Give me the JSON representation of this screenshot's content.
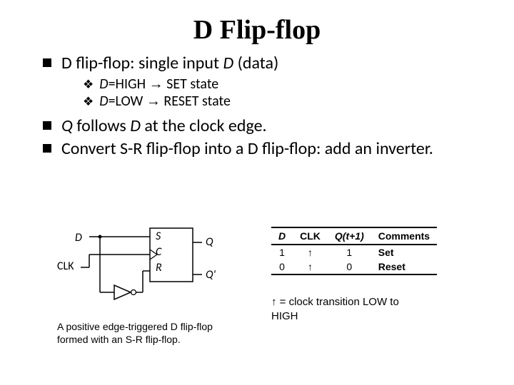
{
  "title": "D Flip-flop",
  "bullets": {
    "b1_pre": "D flip-flop: single input ",
    "b1_em": "D",
    "b1_post": " (data)",
    "s1_pre": "D",
    "s1_mid": "=HIGH ",
    "s1_post": " SET state",
    "s2_pre": "D",
    "s2_mid": "=LOW ",
    "s2_post": " RESET state",
    "b2_em": "Q",
    "b2_mid": " follows ",
    "b2_em2": "D",
    "b2_post": " at the clock edge.",
    "b3": "Convert S-R flip-flop into a D flip-flop: add an inverter."
  },
  "diagram": {
    "D": "D",
    "CLK": "CLK",
    "S": "S",
    "C": "C",
    "R": "R",
    "Q": "Q",
    "Qb": "Q'",
    "caption": "A positive edge-triggered D flip-flop formed with an S-R flip-flop."
  },
  "table": {
    "headers": [
      "D",
      "CLK",
      "Q(t+1)",
      "Comments"
    ],
    "rows": [
      [
        "1",
        "↑",
        "1",
        "Set"
      ],
      [
        "0",
        "↑",
        "0",
        "Reset"
      ]
    ]
  },
  "legend_pre": "↑ = clock transition LOW to",
  "legend_post": "HIGH",
  "glyphs": {
    "diamond": "❖",
    "arrow": "→"
  }
}
